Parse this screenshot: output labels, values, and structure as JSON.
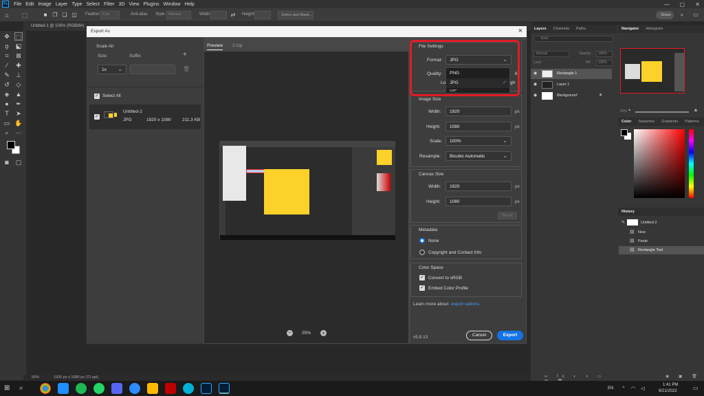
{
  "menubar": {
    "logo": "Ps",
    "items": [
      "File",
      "Edit",
      "Image",
      "Layer",
      "Type",
      "Select",
      "Filter",
      "3D",
      "View",
      "Plugins",
      "Window",
      "Help"
    ]
  },
  "options": {
    "feather_label": "Feather:",
    "feather_value": "0 px",
    "antialias_label": "Anti-alias",
    "style_label": "Style:",
    "style_value": "Normal",
    "width_label": "Width:",
    "height_label": "Height:",
    "select_mask": "Select and Mask...",
    "share": "Share"
  },
  "doc_tab": "Untitled-1 @ 100% (RGB/8#)",
  "status": {
    "zoom": "50%",
    "info": "1920 px x 1080 px (72 ppi)"
  },
  "dialog": {
    "title": "Export As",
    "scale_all": "Scale All",
    "size_label": "Size:",
    "suffix_label": "Suffix:",
    "size_value": "1x",
    "select_all": "Select All",
    "asset": {
      "name": "Untitled-2",
      "format": "JPG",
      "dims": "1920 x 1080",
      "size": "211.3 KB"
    },
    "preview_tabs": [
      "Preview",
      "2-Up"
    ],
    "zoom": "25%",
    "file_settings": "File Settings",
    "format_label": "Format:",
    "format_value": "JPG",
    "format_options": [
      "PNG",
      "JPG"
    ],
    "quality_label": "Quality:",
    "quality_value_partial": "6",
    "lo_partial": "Lo",
    "gh_partial": "gh",
    "gif_partial": "GIF",
    "image_size": "Image Size",
    "width_label": "Width:",
    "width_value": "1920",
    "height_label": "Height:",
    "height_value": "1080",
    "scale_label": "Scale:",
    "scale_value": "100%",
    "resample_label": "Resample:",
    "resample_value": "Bicubic Automatic",
    "px": "px",
    "canvas_size": "Canvas Size",
    "canvas_width": "1920",
    "canvas_height": "1080",
    "reset": "Reset",
    "metadata": "Metadata",
    "meta_none": "None",
    "meta_copyright": "Copyright and Contact Info",
    "color_space": "Color Space",
    "convert_srgb": "Convert to sRGB",
    "embed_profile": "Embed Color Profile",
    "learn_more": "Learn more about",
    "learn_link": "export options.",
    "version": "v5.8.13",
    "cancel": "Cancel",
    "export": "Export"
  },
  "panels": {
    "layers_tabs": [
      "Layers",
      "Channels",
      "Paths"
    ],
    "kind": "Kind",
    "blend": "Normal",
    "opacity_label": "Opacity:",
    "opacity_value": "100%",
    "lock_label": "Lock:",
    "fill_label": "Fill:",
    "fill_value": "100%",
    "layers": [
      "Rectangle 1",
      "Layer 1",
      "Background"
    ],
    "nav_tabs": [
      "Navigator",
      "Histogram"
    ],
    "nav_zoom": "50%",
    "color_tabs": [
      "Color",
      "Swatches",
      "Gradients",
      "Patterns"
    ],
    "history_tab": "History",
    "history_items": [
      "Untitled-2",
      "New",
      "Paste",
      "Rectangle Tool"
    ]
  },
  "taskbar": {
    "lang": "EN",
    "time": "1:41 PM",
    "date": "9/21/2022"
  },
  "colors": {
    "accent": "#1473e6",
    "highlight_red": "#e31b23",
    "yellow": "#fcd12a"
  }
}
